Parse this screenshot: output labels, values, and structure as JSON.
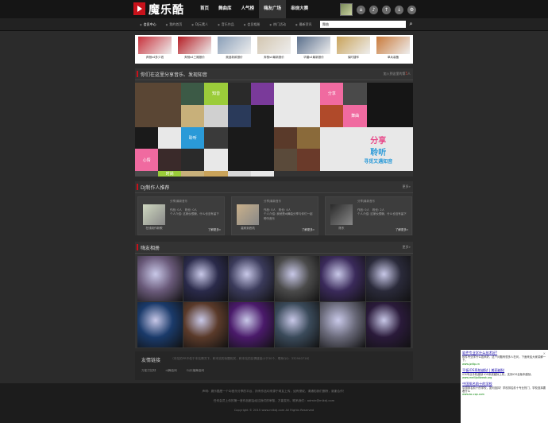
{
  "brand": {
    "logo_text": "魔乐酷"
  },
  "main_nav": [
    {
      "label": "首页",
      "active": false
    },
    {
      "label": "舞曲库",
      "active": false
    },
    {
      "label": "人气榜",
      "active": false
    },
    {
      "label": "嗨友广场",
      "active": true
    },
    {
      "label": "串烧大赛",
      "active": false
    }
  ],
  "top_icons": [
    "home-icon",
    "music-icon",
    "upload-icon",
    "download-icon",
    "settings-icon"
  ],
  "sub_nav": [
    {
      "label": "会员中心",
      "active": true
    },
    {
      "label": "我的首页",
      "active": false
    },
    {
      "label": "DJ元素人",
      "active": false
    },
    {
      "label": "音乐作品",
      "active": false
    },
    {
      "label": "会员相册",
      "active": false
    },
    {
      "label": "热门活动",
      "active": false
    },
    {
      "label": "最新资讯",
      "active": false
    }
  ],
  "search": {
    "value": "舞曲",
    "placeholder": ""
  },
  "strip": [
    {
      "caption": "奔驰s4多少钱",
      "color": "#c8323c"
    },
    {
      "caption": "奔驰s4三厢报价",
      "color": "#b51d24"
    },
    {
      "caption": "奥迪新款报价",
      "color": "#8a9fb8"
    },
    {
      "caption": "奔驰s4最新报价",
      "color": "#d3c6b0"
    },
    {
      "caption": "华晨s4最新报价",
      "color": "#5a6f8c"
    },
    {
      "caption": "保时捷车",
      "color": "#c9a35a"
    },
    {
      "caption": "单兵装备",
      "color": "#c97a3a"
    }
  ],
  "share_panel": {
    "title": "你们在这里分享音乐、发现知音",
    "right_prefix": "加入到这里的第",
    "right_count": "5",
    "right_suffix": "人",
    "tiles": [
      {
        "t": "",
        "c": "#5a4634",
        "big": true
      },
      {
        "t": "",
        "c": "#3c5a46"
      },
      {
        "t": "知音",
        "c": "#9bcc3a"
      },
      {
        "t": "",
        "c": "#2a2a2a"
      },
      {
        "t": "",
        "c": "#7a3a9a"
      },
      {
        "t": "",
        "c": "#e8e8e8",
        "big": true
      },
      {
        "t": "分享",
        "c": "#f06aa0"
      },
      {
        "t": "",
        "c": "#4a4a4a"
      },
      {
        "t": "",
        "c": "#151515",
        "big": true
      },
      {
        "t": "",
        "c": "#c8b07a"
      },
      {
        "t": "",
        "c": "#d0d0d0"
      },
      {
        "t": "",
        "c": "#2a3a5a"
      },
      {
        "t": "",
        "c": "#1a1a1a"
      },
      {
        "t": "",
        "c": "#b04a2a"
      },
      {
        "t": "舞曲",
        "c": "#f06aa0"
      },
      {
        "t": "",
        "c": "#1a1a1a"
      },
      {
        "t": "",
        "c": "#e8e8e8"
      },
      {
        "t": "聆听",
        "c": "#2a9ad8"
      },
      {
        "t": "",
        "c": "#3a3a3a"
      },
      {
        "t": "",
        "c": "#1a1a1a",
        "big": true
      },
      {
        "t": "",
        "c": "#5a3a2a"
      },
      {
        "t": "",
        "c": "#8a6a3a"
      },
      {
        "t": "",
        "c": "#e8e8e8"
      },
      {
        "t": "心情",
        "c": "#f06aa0"
      },
      {
        "t": "",
        "c": "#3a2a2a"
      },
      {
        "t": "",
        "c": "#2a2a2a"
      },
      {
        "t": "",
        "c": "#e8e8e8"
      },
      {
        "t": "",
        "c": "#5a4a3a"
      },
      {
        "t": "",
        "c": "#6a3a2a"
      },
      {
        "t": "",
        "c": "#e8e8e8"
      },
      {
        "t": "",
        "c": "#4a4a4a"
      },
      {
        "t": "时尚",
        "c": "#9bcc3a"
      },
      {
        "t": "",
        "c": "#c8b07a"
      },
      {
        "t": "",
        "c": "#c9a35a"
      },
      {
        "t": "",
        "c": "#d8d8d8"
      },
      {
        "t": "",
        "c": "#e8e8e8"
      }
    ],
    "promo": {
      "line1": "分享",
      "line2": "聆听",
      "line3": "寻觅又遇知音"
    }
  },
  "dj_panel": {
    "title": "DJ制作人推荐",
    "more": "更多»",
    "cards": [
      {
        "name": "在线制作新歌",
        "header": "分享|最新音乐",
        "works": "作品: 0人",
        "fans": "粉丝: 0人",
        "intro": "个人介绍: 这家伙很懒，什么也没有留下",
        "more": "了解更多»",
        "color": "#cfd8c0"
      },
      {
        "name": "嘉莉到底机",
        "header": "分享|最新音乐",
        "works": "作品: 0人",
        "fans": "粉丝: 4人",
        "intro": "个人介绍: 我就是dj舞曲分享与你们一起聆听音乐",
        "more": "了解更多»",
        "color": "#c9b08a"
      },
      {
        "name": "陈东",
        "header": "分享|最新音乐",
        "works": "作品: 0人",
        "fans": "粉丝: 2人",
        "intro": "个人介绍: 这家伙很懒，什么也没有留下",
        "more": "了解更多»",
        "color": "#2a2a2a"
      }
    ]
  },
  "photos_panel": {
    "title": "嗨友相册",
    "more": "更多»",
    "photos": [
      "#6a5a7a",
      "#2a2a4a",
      "#3a3a5a",
      "#4a4a4a",
      "#3a2a5a",
      "#2a2a3a",
      "#1a3a6a",
      "#5a3a2a",
      "#4a1a6a",
      "#3a4a5a",
      "#6a6a7a",
      "#2a1a3a"
    ]
  },
  "friend_links": {
    "title": "友情链接",
    "desc": "（本站的PR不低于本站情况下，和本站的标题相关，和本站的友情链接小于30个，联系QQ：332940716）",
    "items": [
      "万能打招呼",
      "dj舞曲网",
      "Dj乐播舞曲网"
    ]
  },
  "footer": {
    "line1": "声明：魔乐酷是一个DJ音乐分享的平台，所有作品均来源于网友上传，如有侵权，请通知我们删除，谢谢合作！",
    "line2": "任何会员上传的第一首作品都会经过我们的审核，方能发布，联系我们：admin@mlkdj.com",
    "line3": "Copyright © 2015 www.mlkdj.com All Rights Reserved"
  },
  "ad": {
    "close": "✕",
    "items": [
      {
        "title": "软件专业学什么技术好?",
        "body": "软件专业学什么技术好，这个问题有很多人在问，下面来给大家讲解一下。",
        "url": "www.jzdtp.cn"
      },
      {
        "title": "平板iOS系统越狱 | 美丽越狱",
        "body": "iOS专业手机越狱 iOS系统越狱上机，支持iOS全版本越狱。",
        "url": "www.meilijailbreak.org"
      },
      {
        "title": "中国排名前十的学校",
        "body": "中国排名前十的学校，如何选择？学校排名前十专业热门，学校选择要看什么",
        "url": "www.bc-cqx.com"
      }
    ]
  }
}
